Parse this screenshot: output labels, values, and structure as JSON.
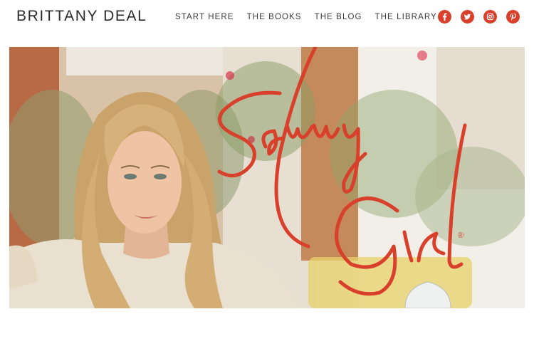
{
  "header": {
    "brand": "BRITTANY DEAL",
    "nav": [
      "START HERE",
      "THE BOOKS",
      "THE BLOG",
      "THE LIBRARY"
    ],
    "social_icons": [
      "facebook-icon",
      "twitter-icon",
      "instagram-icon",
      "pinterest-icon"
    ]
  },
  "hero": {
    "logo_text": "Savvy Girl",
    "registered_mark": "®"
  },
  "colors": {
    "accent": "#d9402b",
    "text": "#2b2b2b"
  }
}
